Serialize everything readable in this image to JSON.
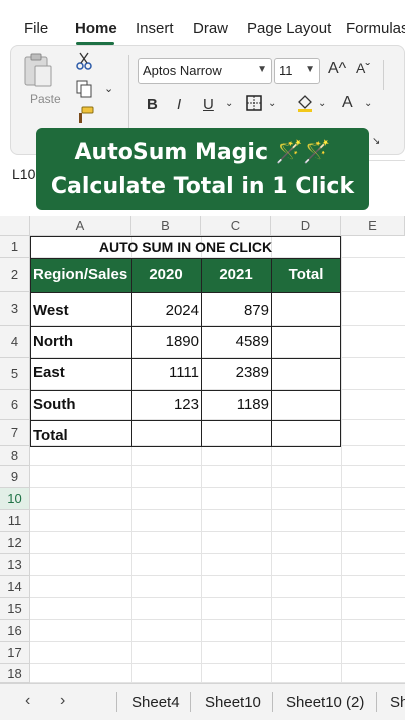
{
  "menu": {
    "tabs": [
      "File",
      "Home",
      "Insert",
      "Draw",
      "Page Layout",
      "Formulas"
    ],
    "active": "Home"
  },
  "ribbon": {
    "paste_label": "Paste",
    "font_name": "Aptos Narrow",
    "font_size": "11",
    "bold": "B",
    "italic": "I",
    "underline": "U",
    "grow_font": "A^",
    "shrink_font": "Aˇ",
    "font_color": "A"
  },
  "banner": {
    "line1": "AutoSum Magic 🪄🪄",
    "line2": "Calculate Total in 1 Click"
  },
  "name_box": "L10",
  "columns": [
    "A",
    "B",
    "C",
    "D",
    "E"
  ],
  "rows": [
    "1",
    "2",
    "3",
    "4",
    "5",
    "6",
    "7",
    "8",
    "9",
    "10",
    "11",
    "12",
    "13",
    "14",
    "15",
    "16",
    "17",
    "18"
  ],
  "selected_row": "10",
  "table": {
    "title": "AUTO SUM IN ONE CLICK",
    "headers": [
      "Region/Sales",
      "2020",
      "2021",
      "Total"
    ],
    "rows": [
      {
        "region": "West",
        "y2020": "2024",
        "y2021": "879"
      },
      {
        "region": "North",
        "y2020": "1890",
        "y2021": "4589"
      },
      {
        "region": "East",
        "y2020": "1111",
        "y2021": "2389"
      },
      {
        "region": "South",
        "y2020": "123",
        "y2021": "1189"
      }
    ],
    "total_label": "Total"
  },
  "sheets": {
    "prev": "‹",
    "next": "›",
    "tabs": [
      "Sheet4",
      "Sheet10",
      "Sheet10 (2)",
      "Sh"
    ]
  },
  "colors": {
    "accent": "#1f6b3b",
    "header_fill": "#1f6b3b"
  }
}
